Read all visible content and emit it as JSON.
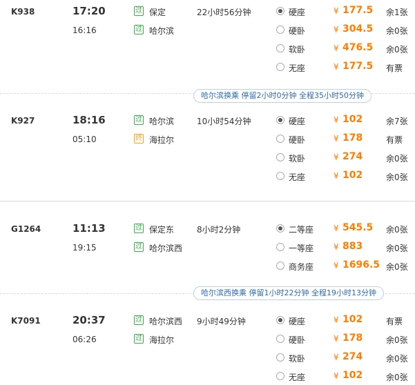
{
  "segments": [
    {
      "train_code": "K938",
      "dep_time": "17:20",
      "arr_time": "16:16",
      "from_badge": "过",
      "from_station": "保定",
      "to_badge": "过",
      "to_station": "哈尔滨",
      "duration": "22小时56分钟",
      "seats": [
        {
          "name": "硬座",
          "yen": "¥",
          "price": "177.5",
          "stock": "余1张",
          "selected": true
        },
        {
          "name": "硬卧",
          "yen": "¥",
          "price": "304.5",
          "stock": "余0张",
          "selected": false
        },
        {
          "name": "软卧",
          "yen": "¥",
          "price": "476.5",
          "stock": "余0张",
          "selected": false
        },
        {
          "name": "无座",
          "yen": "¥",
          "price": "177.5",
          "stock": "有票",
          "selected": false
        }
      ]
    },
    {
      "train_code": "K927",
      "dep_time": "18:16",
      "arr_time": "05:10",
      "from_badge": "过",
      "from_station": "哈尔滨",
      "to_badge": "终",
      "to_station": "海拉尔",
      "duration": "10小时54分钟",
      "seats": [
        {
          "name": "硬座",
          "yen": "¥",
          "price": "102",
          "stock": "余7张",
          "selected": true
        },
        {
          "name": "硬卧",
          "yen": "¥",
          "price": "178",
          "stock": "有票",
          "selected": false
        },
        {
          "name": "软卧",
          "yen": "¥",
          "price": "274",
          "stock": "余0张",
          "selected": false
        },
        {
          "name": "无座",
          "yen": "¥",
          "price": "102",
          "stock": "余0张",
          "selected": false
        }
      ]
    },
    {
      "train_code": "G1264",
      "dep_time": "11:13",
      "arr_time": "19:15",
      "from_badge": "过",
      "from_station": "保定东",
      "to_badge": "过",
      "to_station": "哈尔滨西",
      "duration": "8小时2分钟",
      "seats": [
        {
          "name": "二等座",
          "yen": "¥",
          "price": "545.5",
          "stock": "余0张",
          "selected": true
        },
        {
          "name": "一等座",
          "yen": "¥",
          "price": "883",
          "stock": "余0张",
          "selected": false
        },
        {
          "name": "商务座",
          "yen": "¥",
          "price": "1696.5",
          "stock": "余0张",
          "selected": false
        }
      ]
    },
    {
      "train_code": "K7091",
      "dep_time": "20:37",
      "arr_time": "06:26",
      "from_badge": "过",
      "from_station": "哈尔滨西",
      "to_badge": "过",
      "to_station": "海拉尔",
      "duration": "9小时49分钟",
      "seats": [
        {
          "name": "硬座",
          "yen": "¥",
          "price": "102",
          "stock": "有票",
          "selected": true
        },
        {
          "name": "硬卧",
          "yen": "¥",
          "price": "178",
          "stock": "余0张",
          "selected": false
        },
        {
          "name": "软卧",
          "yen": "¥",
          "price": "274",
          "stock": "余0张",
          "selected": false
        },
        {
          "name": "无座",
          "yen": "¥",
          "price": "102",
          "stock": "余0张",
          "selected": false
        }
      ]
    }
  ],
  "transfers": [
    {
      "text": "哈尔滨换乘 停留2小时0分钟 全程35小时50分钟"
    },
    {
      "text": "哈尔滨西换乘 停留1小时22分钟 全程19小时13分钟"
    }
  ],
  "colors": {
    "price": "#ff7e00",
    "pass_badge": "#3cb04a",
    "terminal_badge": "#f5a623",
    "transfer_text": "#2a6bb5"
  }
}
